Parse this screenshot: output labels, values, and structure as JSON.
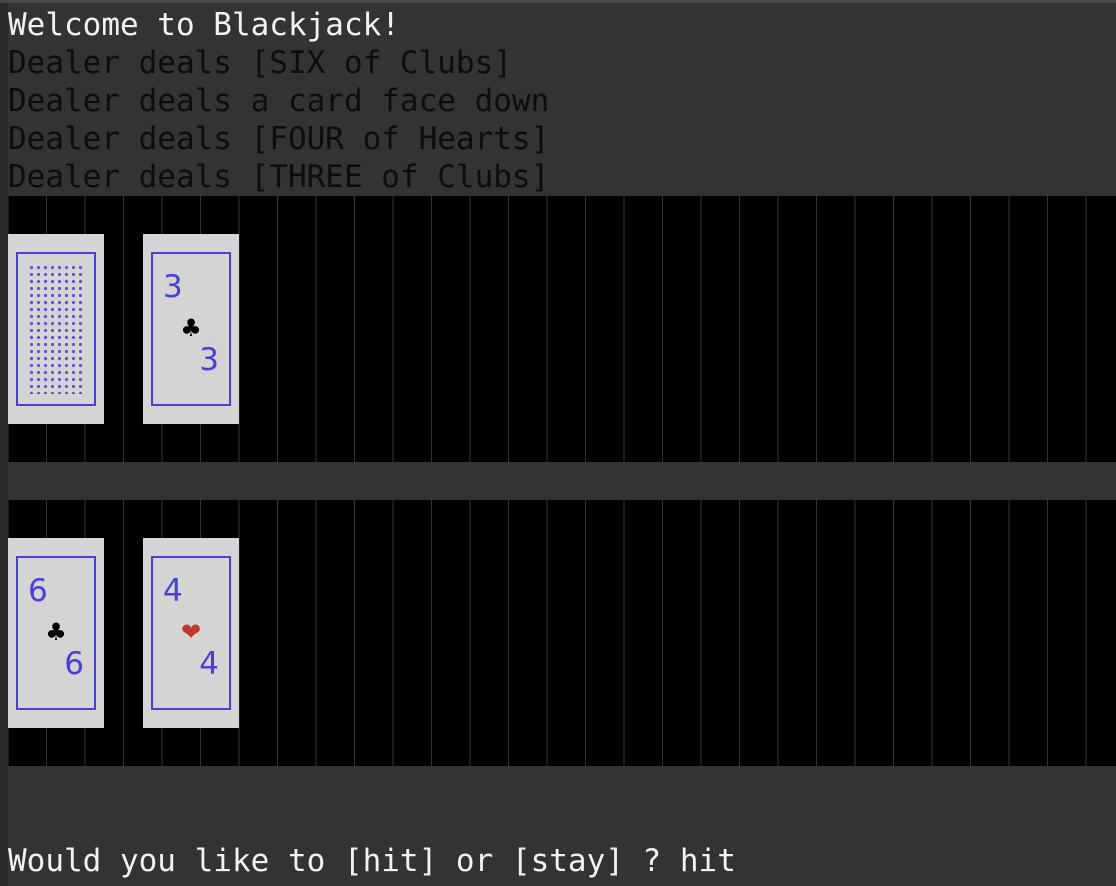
{
  "log": [
    "Welcome to Blackjack!",
    "Dealer deals [SIX of Clubs]",
    "Dealer deals a card face down",
    "Dealer deals [FOUR of Hearts]",
    "Dealer deals [THREE of Clubs]"
  ],
  "dealer_hand": [
    {
      "face_down": true
    },
    {
      "rank": "3",
      "suit": "♣",
      "suit_icon": "club-icon",
      "suit_color": "#000000"
    }
  ],
  "player_hand": [
    {
      "rank": "6",
      "suit": "♣",
      "suit_icon": "club-icon",
      "suit_color": "#000000"
    },
    {
      "rank": "4",
      "suit": "❤",
      "suit_icon": "heart-icon",
      "suit_color": "#c0392b"
    }
  ],
  "prompt": {
    "question": "Would you like to [hit] or [stay] ? hit"
  },
  "colors": {
    "background": "#333333",
    "table": "#000000",
    "card_face": "#d4d4d4",
    "card_ink": "#4a3fd6"
  }
}
